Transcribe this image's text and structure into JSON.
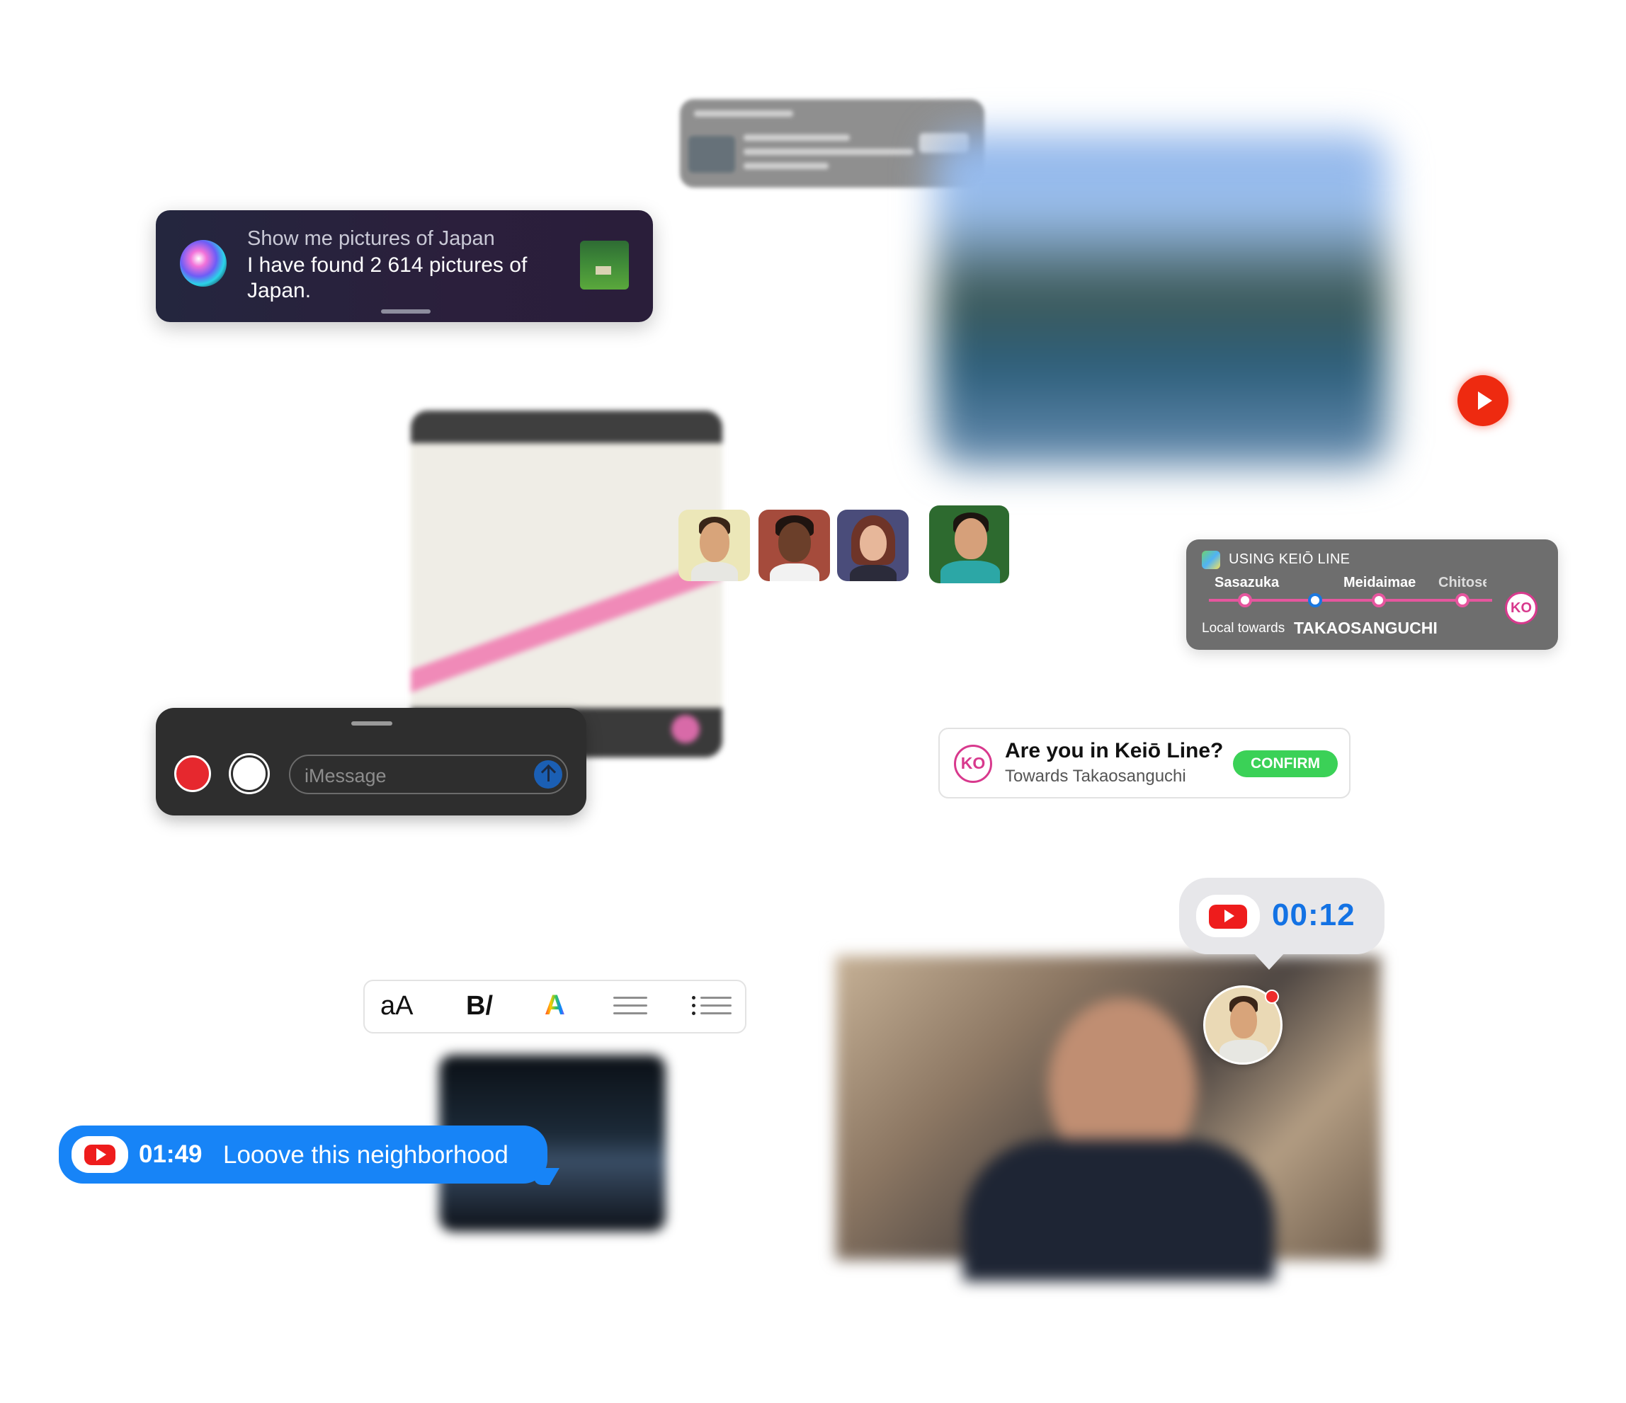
{
  "siri": {
    "query": "Show me pictures of Japan",
    "answer": "I have found 2 614 pictures of Japan."
  },
  "transit": {
    "title": "USING KEIŌ LINE",
    "stations": [
      "Sasazuka",
      "Meidaimae",
      "Chitose"
    ],
    "direction_label": "Local towards",
    "destination": "TAKAOSANGUCHI",
    "badge": "KO"
  },
  "keio_prompt": {
    "badge": "KO",
    "question": "Are you in Keiō Line?",
    "subtitle": "Towards Takaosanguchi",
    "confirm_label": "CONFIRM"
  },
  "imessage": {
    "placeholder": "iMessage"
  },
  "format_toolbar": {
    "text_size_label": "aA",
    "bold_italic_label": "B/",
    "color_label": "A"
  },
  "message_bubble": {
    "timestamp": "01:49",
    "text": "Looove this neighborhood"
  },
  "timer": {
    "time": "00:12"
  },
  "icons": {
    "siri": "siri-orb-icon",
    "youtube": "youtube-icon",
    "play": "play-icon",
    "maps": "maps-app-icon",
    "send": "send-arrow-icon"
  },
  "colors": {
    "keio_pink": "#d8398d",
    "confirm_green": "#3bd157",
    "bubble_blue": "#1784f7",
    "timer_blue": "#1372e4",
    "youtube_red": "#ee1c1c"
  }
}
